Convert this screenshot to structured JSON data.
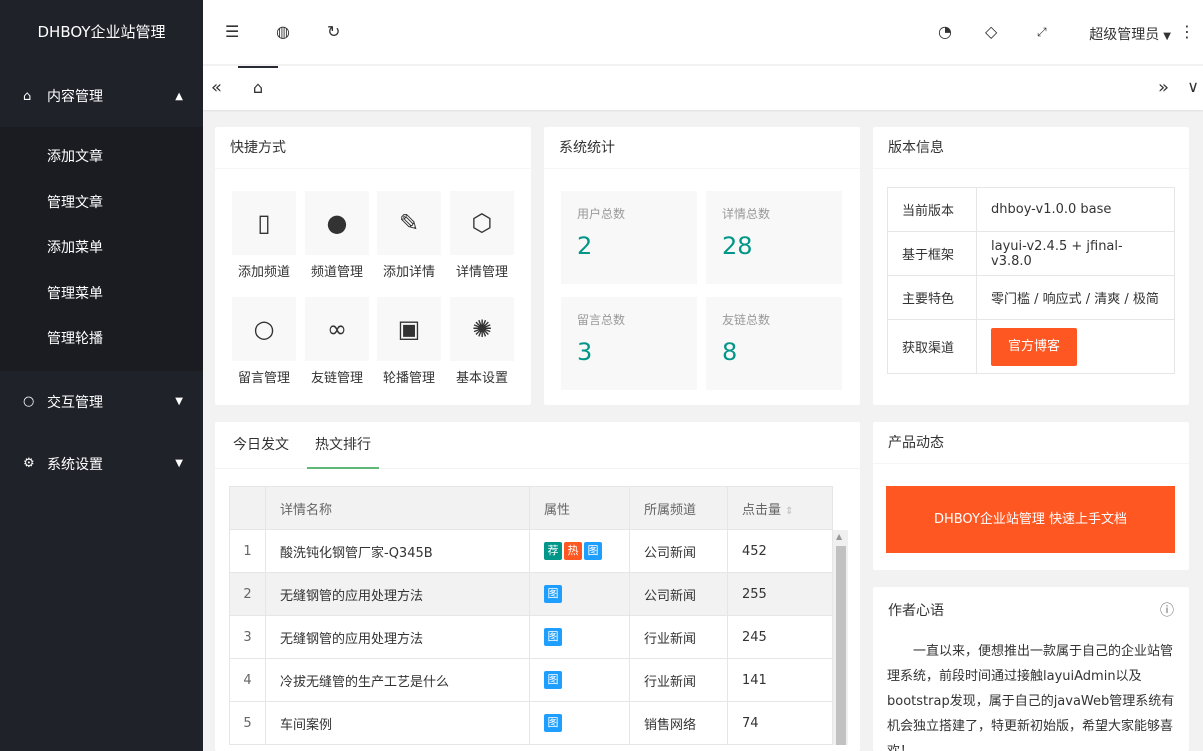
{
  "app": {
    "title": "DHBOY企业站管理"
  },
  "sidebar": {
    "groups": [
      {
        "label": "内容管理",
        "icon": "home-icon",
        "items": [
          "添加文章",
          "管理文章",
          "添加菜单",
          "管理菜单",
          "管理轮播"
        ]
      },
      {
        "label": "交互管理",
        "icon": "bubble-icon"
      },
      {
        "label": "系统设置",
        "icon": "gear-icon"
      }
    ]
  },
  "header": {
    "admin": "超级管理员"
  },
  "shortcuts": {
    "title": "快捷方式",
    "items": [
      {
        "label": "添加频道",
        "icon": "file-icon"
      },
      {
        "label": "频道管理",
        "icon": "compass-icon"
      },
      {
        "label": "添加详情",
        "icon": "edit-icon"
      },
      {
        "label": "详情管理",
        "icon": "cube-icon"
      },
      {
        "label": "留言管理",
        "icon": "chat-icon"
      },
      {
        "label": "友链管理",
        "icon": "link-icon"
      },
      {
        "label": "轮播管理",
        "icon": "picture-icon"
      },
      {
        "label": "基本设置",
        "icon": "settings-icon"
      }
    ]
  },
  "stats": {
    "title": "系统统计",
    "items": [
      {
        "label": "用户总数",
        "value": "2"
      },
      {
        "label": "详情总数",
        "value": "28"
      },
      {
        "label": "留言总数",
        "value": "3"
      },
      {
        "label": "友链总数",
        "value": "8"
      }
    ]
  },
  "version": {
    "title": "版本信息",
    "rows": [
      {
        "k": "当前版本",
        "v": "dhboy-v1.0.0 base"
      },
      {
        "k": "基于框架",
        "v": "layui-v2.4.5 + jfinal-v3.8.0"
      },
      {
        "k": "主要特色",
        "v": "零门槛 / 响应式 / 清爽 / 极简"
      },
      {
        "k": "获取渠道",
        "v": "官方博客"
      }
    ]
  },
  "hot": {
    "tabs": [
      "今日发文",
      "热文排行"
    ],
    "columns": [
      "详情名称",
      "属性",
      "所属频道",
      "点击量"
    ],
    "rows": [
      {
        "n": "1",
        "name": "酸洗钝化钢管厂家-Q345B",
        "tags": [
          "荐",
          "热",
          "图"
        ],
        "channel": "公司新闻",
        "clicks": "452"
      },
      {
        "n": "2",
        "name": "无缝钢管的应用处理方法",
        "tags": [
          "图"
        ],
        "channel": "公司新闻",
        "clicks": "255"
      },
      {
        "n": "3",
        "name": "无缝钢管的应用处理方法",
        "tags": [
          "图"
        ],
        "channel": "行业新闻",
        "clicks": "245"
      },
      {
        "n": "4",
        "name": "冷拔无缝管的生产工艺是什么",
        "tags": [
          "图"
        ],
        "channel": "行业新闻",
        "clicks": "141"
      },
      {
        "n": "5",
        "name": "车间案例",
        "tags": [
          "图"
        ],
        "channel": "销售网络",
        "clicks": "74"
      }
    ]
  },
  "product": {
    "title": "产品动态",
    "button": "DHBOY企业站管理 快速上手文档"
  },
  "author": {
    "title": "作者心语",
    "text": "一直以来，便想推出一款属于自己的企业站管理系统，前段时间通过接触layuiAdmin以及bootstrap发现，属于自己的javaWeb管理系统有机会独立搭建了，特更新初始版，希望大家能够喜欢！"
  },
  "colors": {
    "accent": "#009688",
    "orange": "#ff5722",
    "green_tab": "#5fb878",
    "tag_green": "#009688",
    "tag_orange": "#ff5722",
    "tag_blue": "#1e9fff"
  }
}
